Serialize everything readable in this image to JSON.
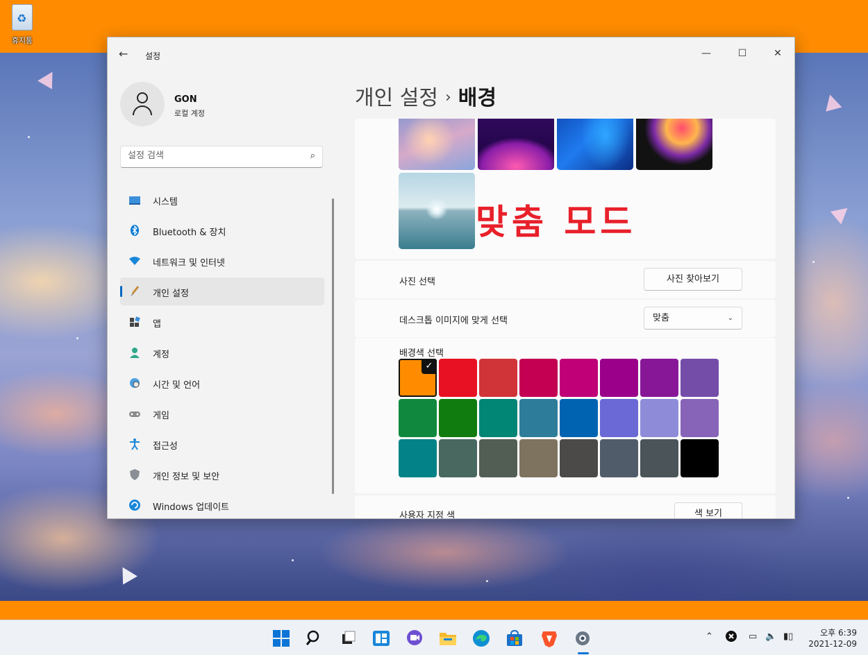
{
  "desktop": {
    "recycle_bin_label": "휴지통"
  },
  "window": {
    "title": "설정",
    "controls": {
      "minimize": "—",
      "maximize": "☐",
      "close": "✕"
    }
  },
  "profile": {
    "name": "GON",
    "subtitle": "로컬 계정"
  },
  "search": {
    "placeholder": "설정 검색"
  },
  "nav": {
    "items": [
      {
        "label": "시스템",
        "icon": "monitor-icon"
      },
      {
        "label": "Bluetooth & 장치",
        "icon": "bluetooth-icon"
      },
      {
        "label": "네트워크 및 인터넷",
        "icon": "wifi-icon"
      },
      {
        "label": "개인 설정",
        "icon": "paintbrush-icon",
        "active": true
      },
      {
        "label": "앱",
        "icon": "apps-icon"
      },
      {
        "label": "계정",
        "icon": "account-icon"
      },
      {
        "label": "시간 및 언어",
        "icon": "globe-clock-icon"
      },
      {
        "label": "게임",
        "icon": "gamepad-icon"
      },
      {
        "label": "접근성",
        "icon": "accessibility-icon"
      },
      {
        "label": "개인 정보 및 보안",
        "icon": "shield-icon"
      },
      {
        "label": "Windows 업데이트",
        "icon": "update-icon"
      }
    ]
  },
  "header": {
    "parent": "개인 설정",
    "separator": "›",
    "current": "배경"
  },
  "background": {
    "fit_annotation": "맞춤 모드",
    "photo_select_label": "사진 선택",
    "browse_button": "사진 찾아보기",
    "fit_select_label": "데스크톱 이미지에 맞게 선택",
    "fit_value": "맞춤",
    "color_select_label": "배경색 선택",
    "selected_color": "#ff8c00",
    "colors": [
      "#ff8c00",
      "#e81123",
      "#d13438",
      "#c30052",
      "#bf0077",
      "#9a0089",
      "#881798",
      "#744da9",
      "#10893e",
      "#107c10",
      "#018574",
      "#2d7d9a",
      "#0063b1",
      "#6b69d6",
      "#8e8cd8",
      "#8764b8",
      "#038387",
      "#486860",
      "#525e54",
      "#7e735f",
      "#4c4a48",
      "#515c6b",
      "#4a5459",
      "#000000"
    ],
    "custom_color_label": "사용자 지정 색",
    "view_colors_button": "색 보기"
  },
  "taskbar": {
    "icons": [
      "windows-start-icon",
      "search-icon",
      "task-view-icon",
      "widgets-icon",
      "chat-icon",
      "file-explorer-icon",
      "edge-icon",
      "store-icon",
      "brave-icon",
      "settings-icon"
    ],
    "time": "오후 6:39",
    "date": "2021-12-09"
  }
}
